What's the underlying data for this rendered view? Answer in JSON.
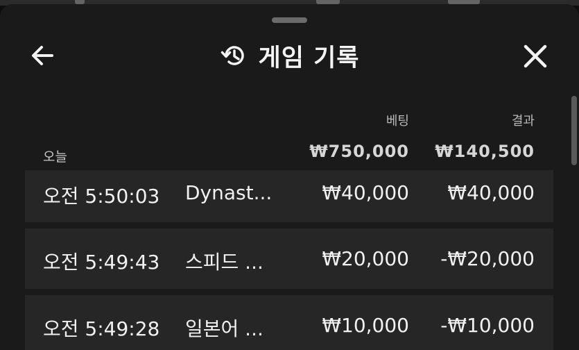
{
  "header": {
    "title": "게임 기록"
  },
  "table": {
    "columns": {
      "bet": "베팅",
      "result": "결과"
    },
    "group": {
      "date_label": "오늘",
      "total_bet": "₩750,000",
      "total_result": "₩140,500"
    },
    "rows": [
      {
        "time": "오전 5:50:03",
        "game": "Dynast...",
        "bet": "₩40,000",
        "result": "₩40,000"
      },
      {
        "time": "오전 5:49:43",
        "game": "스피드 ...",
        "bet": "₩20,000",
        "result": "-₩20,000"
      },
      {
        "time": "오전 5:49:28",
        "game": "일본어 ...",
        "bet": "₩10,000",
        "result": "-₩10,000"
      }
    ]
  },
  "icons": {
    "back": "arrow-left-icon",
    "history": "history-clock-icon",
    "close": "close-x-icon"
  },
  "colors": {
    "sheet_background": "#1a1a1a",
    "row_background": "#262626",
    "text_primary": "#f1f1f1",
    "text_secondary": "#b9b9b9"
  }
}
